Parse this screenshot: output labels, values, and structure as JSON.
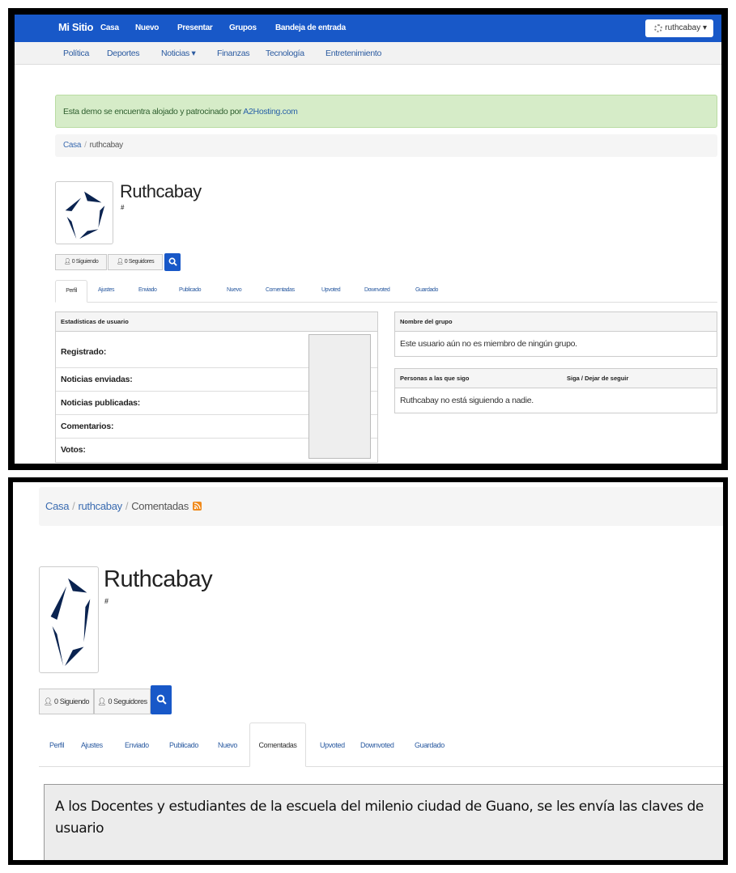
{
  "navbar": {
    "brand": "Mi Sitio",
    "links": [
      "Casa",
      "Nuevo",
      "Presentar",
      "Grupos",
      "Bandeja de entrada"
    ],
    "user_menu": "ruthcabay ▾",
    "user_icon": "spinner-icon"
  },
  "subnav": {
    "links": [
      "Política",
      "Deportes",
      "Noticias ▾",
      "Finanzas",
      "Tecnología",
      "Entretenimiento"
    ]
  },
  "alert": {
    "text": "Esta demo se encuentra alojado y patrocinado por ",
    "link": "A2Hosting.com"
  },
  "breadcrumb1": {
    "items": [
      "Casa",
      "ruthcabay"
    ],
    "separator": "/"
  },
  "profile": {
    "username": "Ruthcabay",
    "hash": "#",
    "following_btn": "0 Siguiendo",
    "followers_btn": "0 Seguidores",
    "user_icon": "user-icon",
    "search_icon": "search-icon"
  },
  "tabs": [
    "Perfil",
    "Ajustes",
    "Enviado",
    "Publicado",
    "Nuevo",
    "Comentadas",
    "Upvoted",
    "Downvoted",
    "Guardado"
  ],
  "tabs_active_1": "Perfil",
  "tabs_active_2": "Comentadas",
  "stats": {
    "header": "Estadísticas de usuario",
    "rows": [
      "Registrado:",
      "Noticias enviadas:",
      "Noticias publicadas:",
      "Comentarios:",
      "Votos:"
    ]
  },
  "groups": {
    "header": "Nombre del grupo",
    "empty_text": "Este usuario aún no es miembro de ningún grupo."
  },
  "following": {
    "header_left": "Personas a las que sigo",
    "header_right": "Siga / Dejar de seguir",
    "empty_text": "Ruthcabay no está siguiendo a nadie."
  },
  "breadcrumb2": {
    "items": [
      "Casa",
      "ruthcabay",
      "Comentadas"
    ],
    "separator": "/",
    "rss_icon": "rss-icon"
  },
  "comment": {
    "text": "A los Docentes y estudiantes de la escuela del milenio ciudad de Guano, se les envía las claves de usuario"
  },
  "colors": {
    "navbar": "#1858c8",
    "alert_bg": "#d6ecc8",
    "link": "#2a5aa0",
    "rss": "#f08a1c"
  }
}
